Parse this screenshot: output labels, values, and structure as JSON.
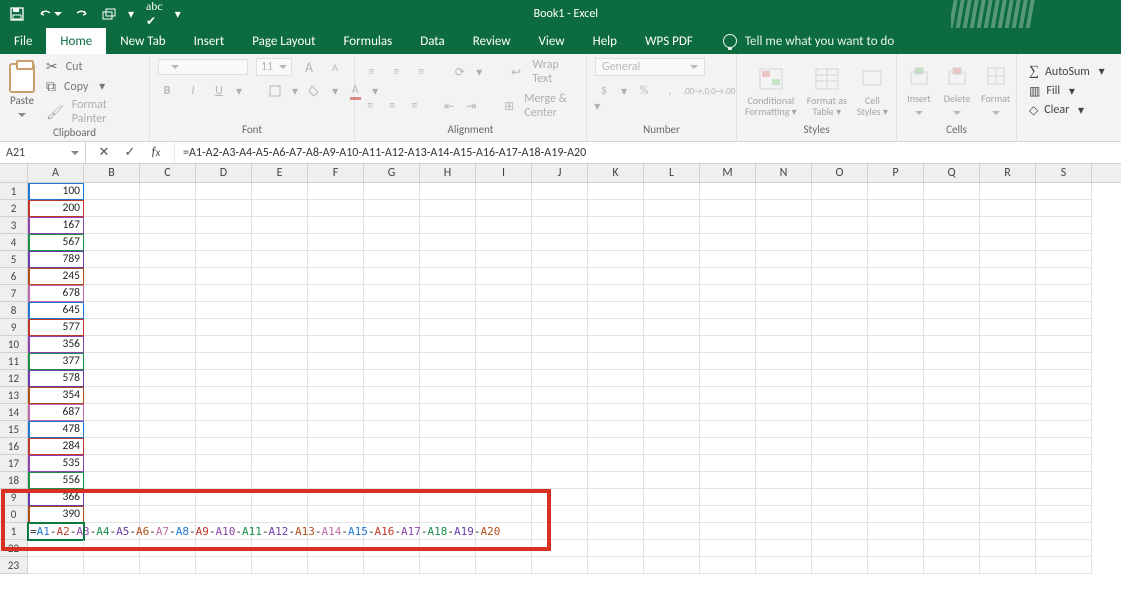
{
  "title": "Book1 - Excel",
  "tabs": [
    "File",
    "Home",
    "New Tab",
    "Insert",
    "Page Layout",
    "Formulas",
    "Data",
    "Review",
    "View",
    "Help",
    "WPS PDF"
  ],
  "active_tab": 1,
  "tell_me_placeholder": "Tell me what you want to do",
  "clipboard": {
    "paste": "Paste",
    "cut": "Cut",
    "copy": "Copy",
    "painter": "Format Painter",
    "label": "Clipboard"
  },
  "font": {
    "size": "11",
    "increase": "A",
    "decrease": "A",
    "bold": "B",
    "italic": "I",
    "underline": "U",
    "fontcolor": "A",
    "label": "Font"
  },
  "alignment": {
    "wrap": "Wrap Text",
    "merge": "Merge & Center",
    "label": "Alignment"
  },
  "number": {
    "format": "General",
    "percent": "%",
    "comma": ",",
    "inc": ".00",
    "dec": ".0",
    "label": "Number"
  },
  "styles": {
    "cond": "Conditional Formatting",
    "table": "Format as Table",
    "cell": "Cell Styles",
    "label": "Styles"
  },
  "cells": {
    "insert": "Insert",
    "delete": "Delete",
    "format": "Format",
    "label": "Cells"
  },
  "editing": {
    "sum": "AutoSum",
    "fill": "Fill",
    "clear": "Clear"
  },
  "namebox": "A21",
  "formula": "=A1-A2-A3-A4-A5-A6-A7-A8-A9-A10-A11-A12-A13-A14-A15-A16-A17-A18-A19-A20",
  "columns": [
    "A",
    "B",
    "C",
    "D",
    "E",
    "F",
    "G",
    "H",
    "I",
    "J",
    "K",
    "L",
    "M",
    "N",
    "O",
    "P",
    "Q",
    "R",
    "S"
  ],
  "col_a_values": [
    100,
    200,
    167,
    567,
    789,
    245,
    678,
    645,
    577,
    356,
    377,
    578,
    354,
    687,
    478,
    284,
    535,
    556,
    366,
    390
  ],
  "a21_formula_tokens": [
    {
      "t": "=",
      "c": "#222"
    },
    {
      "t": "A1",
      "c": "#1f77d0"
    },
    {
      "t": "-",
      "c": "#222"
    },
    {
      "t": "A2",
      "c": "#c0392b"
    },
    {
      "t": "-",
      "c": "#222"
    },
    {
      "t": "A3",
      "c": "#8e44ad"
    },
    {
      "t": "-",
      "c": "#222"
    },
    {
      "t": "A4",
      "c": "#1c8f4b"
    },
    {
      "t": "-",
      "c": "#222"
    },
    {
      "t": "A5",
      "c": "#6a3da6"
    },
    {
      "t": "-",
      "c": "#222"
    },
    {
      "t": "A6",
      "c": "#b14f1b"
    },
    {
      "t": "-",
      "c": "#222"
    },
    {
      "t": "A7",
      "c": "#c16aa8"
    },
    {
      "t": "-",
      "c": "#222"
    },
    {
      "t": "A8",
      "c": "#1f77d0"
    },
    {
      "t": "-",
      "c": "#222"
    },
    {
      "t": "A9",
      "c": "#c0392b"
    },
    {
      "t": "-",
      "c": "#222"
    },
    {
      "t": "A10",
      "c": "#8e44ad"
    },
    {
      "t": "-",
      "c": "#222"
    },
    {
      "t": "A11",
      "c": "#1c8f4b"
    },
    {
      "t": "-",
      "c": "#222"
    },
    {
      "t": "A12",
      "c": "#6a3da6"
    },
    {
      "t": "-",
      "c": "#222"
    },
    {
      "t": "A13",
      "c": "#b14f1b"
    },
    {
      "t": "-",
      "c": "#222"
    },
    {
      "t": "A14",
      "c": "#c16aa8"
    },
    {
      "t": "-",
      "c": "#222"
    },
    {
      "t": "A15",
      "c": "#1f77d0"
    },
    {
      "t": "-",
      "c": "#222"
    },
    {
      "t": "A16",
      "c": "#c0392b"
    },
    {
      "t": "-",
      "c": "#222"
    },
    {
      "t": "A17",
      "c": "#8e44ad"
    },
    {
      "t": "-",
      "c": "#222"
    },
    {
      "t": "A18",
      "c": "#1c8f4b"
    },
    {
      "t": "-",
      "c": "#222"
    },
    {
      "t": "A19",
      "c": "#6a3da6"
    },
    {
      "t": "-",
      "c": "#222"
    },
    {
      "t": "A20",
      "c": "#b14f1b"
    }
  ],
  "barcolors": [
    "#1f77d0",
    "#c0392b",
    "#8e44ad",
    "#1c8f4b",
    "#6a3da6",
    "#b14f1b",
    "#c16aa8",
    "#1f77d0",
    "#c0392b",
    "#8e44ad",
    "#1c8f4b",
    "#6a3da6",
    "#b14f1b",
    "#c16aa8",
    "#1f77d0",
    "#c0392b",
    "#8e44ad",
    "#1c8f4b",
    "#6a3da6",
    "#b14f1b"
  ],
  "visible_rows": 23
}
